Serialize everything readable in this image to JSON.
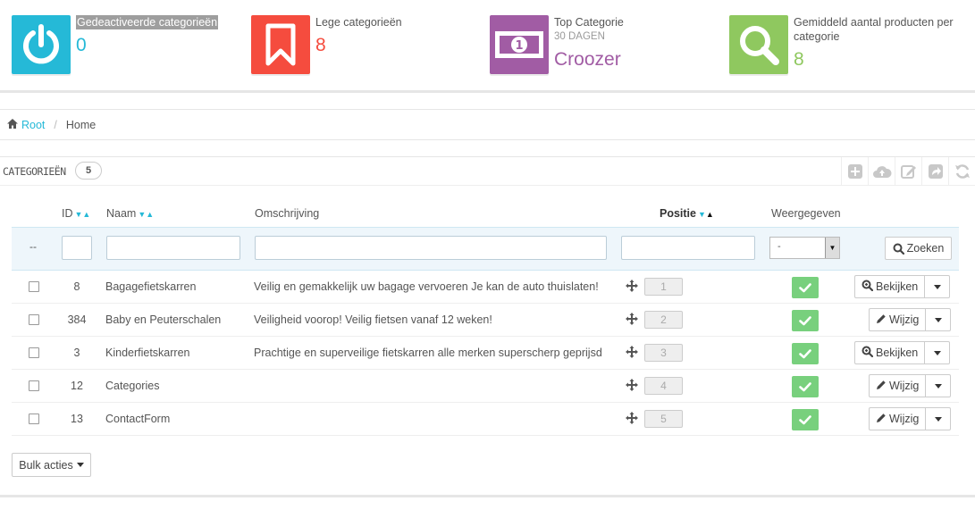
{
  "kpis": [
    {
      "title": "Gedeactiveerde categorieën",
      "value": "0",
      "color": "#25b9d7",
      "icon": "power-icon"
    },
    {
      "title": "Lege categorieën",
      "value": "8",
      "color": "#f54c3e",
      "icon": "bookmark-icon"
    },
    {
      "title": "Top Categorie",
      "subtitle": "30 DAGEN",
      "value": "Croozer",
      "color": "#a15ca4",
      "icon": "money-icon"
    },
    {
      "title": "Gemiddeld aantal producten per categorie",
      "value": "8",
      "color": "#8fc85f",
      "icon": "search-icon"
    }
  ],
  "breadcrumb": {
    "root": "Root",
    "current": "Home",
    "separator": "/"
  },
  "panel": {
    "title": "CATEGORIEËN",
    "count": "5"
  },
  "columns": {
    "id": "ID",
    "name": "Naam",
    "description": "Omschrijving",
    "position": "Positie",
    "displayed": "Weergegeven"
  },
  "filters": {
    "dash": "--",
    "select_value": "-",
    "search_button": "Zoeken"
  },
  "rows": [
    {
      "id": "8",
      "name": "Bagagefietskarren",
      "description": "Veilig en gemakkelijk uw bagage vervoeren Je kan de auto thuislaten!",
      "position": "1",
      "action": "Bekijken"
    },
    {
      "id": "384",
      "name": "Baby en Peuterschalen",
      "description": "Veiligheid voorop! Veilig fietsen vanaf 12 weken!",
      "position": "2",
      "action": "Wijzig"
    },
    {
      "id": "3",
      "name": "Kinderfietskarren",
      "description": "Prachtige en superveilige fietskarren alle merken superscherp geprijsd",
      "position": "3",
      "action": "Bekijken"
    },
    {
      "id": "12",
      "name": "Categories",
      "description": "",
      "position": "4",
      "action": "Wijzig"
    },
    {
      "id": "13",
      "name": "ContactForm",
      "description": "",
      "position": "5",
      "action": "Wijzig"
    }
  ],
  "bulk_button": "Bulk acties"
}
